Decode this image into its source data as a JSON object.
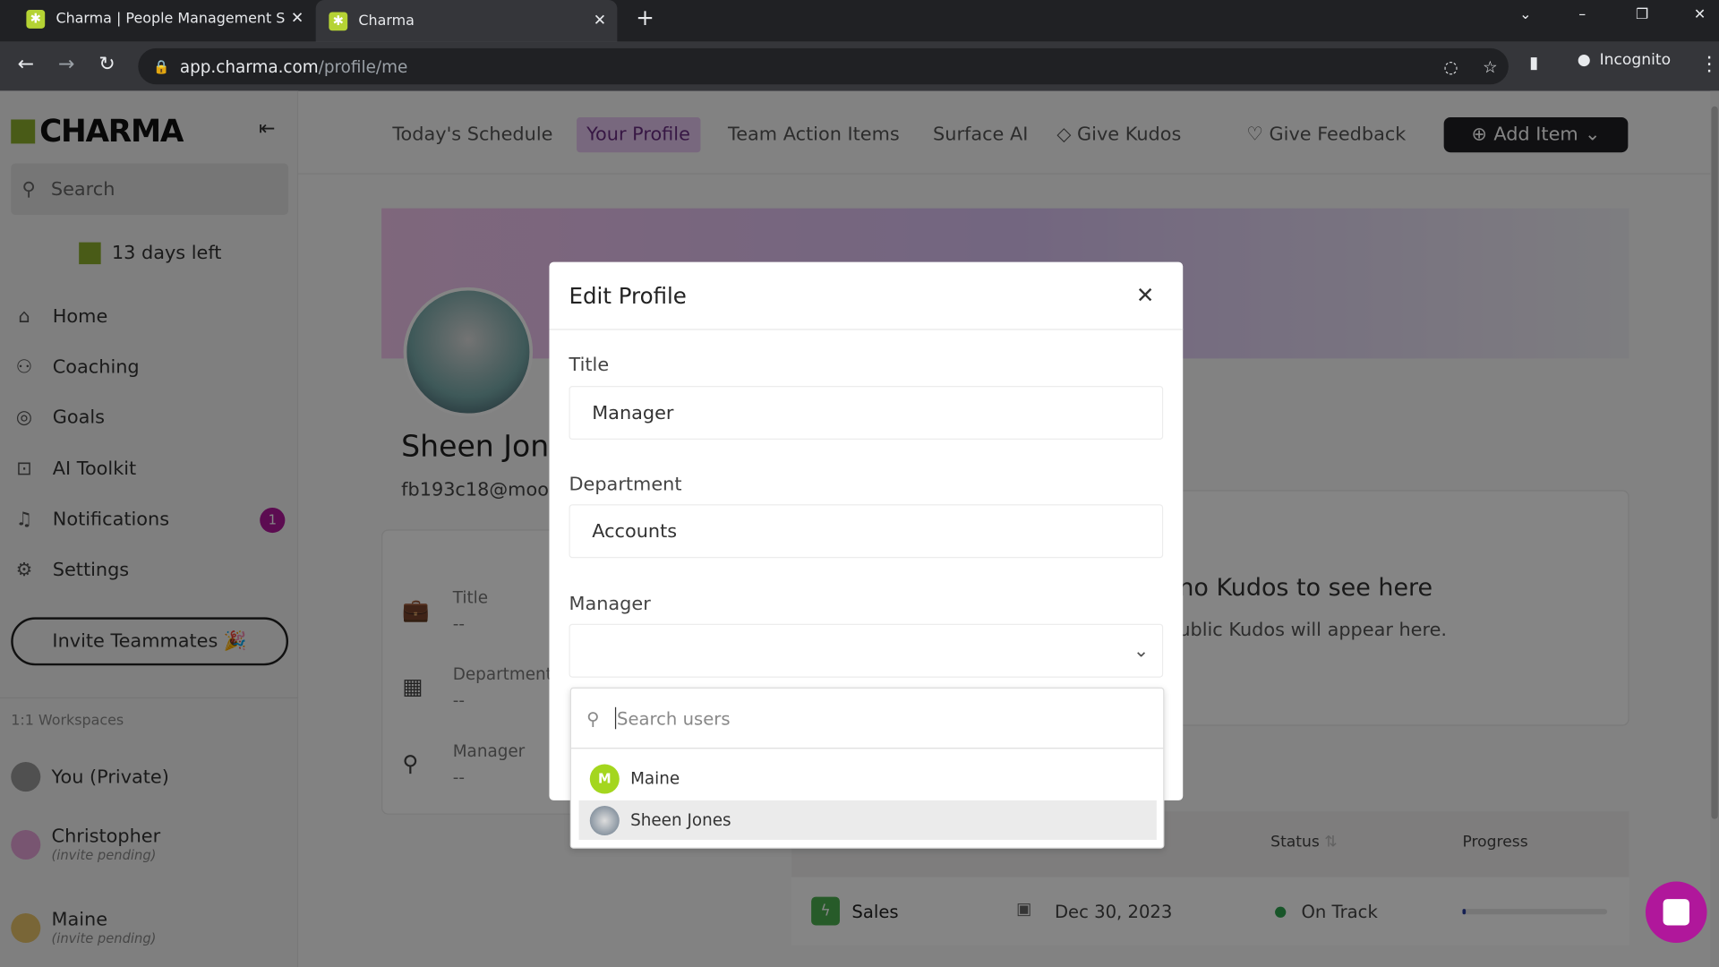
{
  "browser": {
    "tabs": [
      {
        "title": "Charma | People Management S"
      },
      {
        "title": "Charma"
      }
    ],
    "url_host": "app.charma.com",
    "url_path": "/profile/me",
    "profile": "Incognito"
  },
  "sidebar": {
    "logo": "CHARMA",
    "search_placeholder": "Search",
    "trial": "13 days left",
    "items": [
      {
        "label": "Home",
        "icon": "home-icon"
      },
      {
        "label": "Coaching",
        "icon": "coaching-icon"
      },
      {
        "label": "Goals",
        "icon": "target-icon"
      },
      {
        "label": "AI Toolkit",
        "icon": "robot-icon"
      },
      {
        "label": "Notifications",
        "icon": "bell-icon",
        "badge": "1"
      },
      {
        "label": "Settings",
        "icon": "gear-icon"
      }
    ],
    "invite": "Invite Teammates 🎉",
    "workspaces_label": "1:1 Workspaces",
    "workspaces": [
      {
        "name": "You (Private)"
      },
      {
        "name": "Christopher",
        "note": "(invite pending)"
      },
      {
        "name": "Maine",
        "note": "(invite pending)"
      }
    ]
  },
  "topnav": {
    "items": [
      "Today's Schedule",
      "Your Profile",
      "Team Action Items",
      "Surface AI",
      "Give Kudos",
      "Give Feedback"
    ],
    "active": "Your Profile",
    "add_item": "Add Item"
  },
  "profile": {
    "name": "Sheen Jones",
    "email": "fb193c18@moo",
    "fields": [
      {
        "label": "Title",
        "value": "--"
      },
      {
        "label": "Department",
        "value": "--"
      },
      {
        "label": "Manager",
        "value": "--"
      }
    ],
    "kudos_title": "no Kudos to see here",
    "kudos_sub": "ublic Kudos will appear here.",
    "goals": {
      "headers": [
        "Status",
        "Progress"
      ],
      "row": {
        "name": "Sales",
        "date": "Dec 30, 2023",
        "status": "On Track",
        "progress": 0.02
      }
    }
  },
  "modal": {
    "title": "Edit Profile",
    "title_label": "Title",
    "title_value": "Manager",
    "department_label": "Department",
    "department_value": "Accounts",
    "manager_label": "Manager",
    "manager_value": "",
    "search_placeholder": "Search users",
    "options": [
      {
        "name": "Maine",
        "initial": "M"
      },
      {
        "name": "Sheen Jones"
      }
    ]
  },
  "colors": {
    "accent": "#b0179b",
    "brand_green": "#8dae2d",
    "active_tab_bg": "#e7c7f2",
    "on_track": "#2ea44f"
  }
}
